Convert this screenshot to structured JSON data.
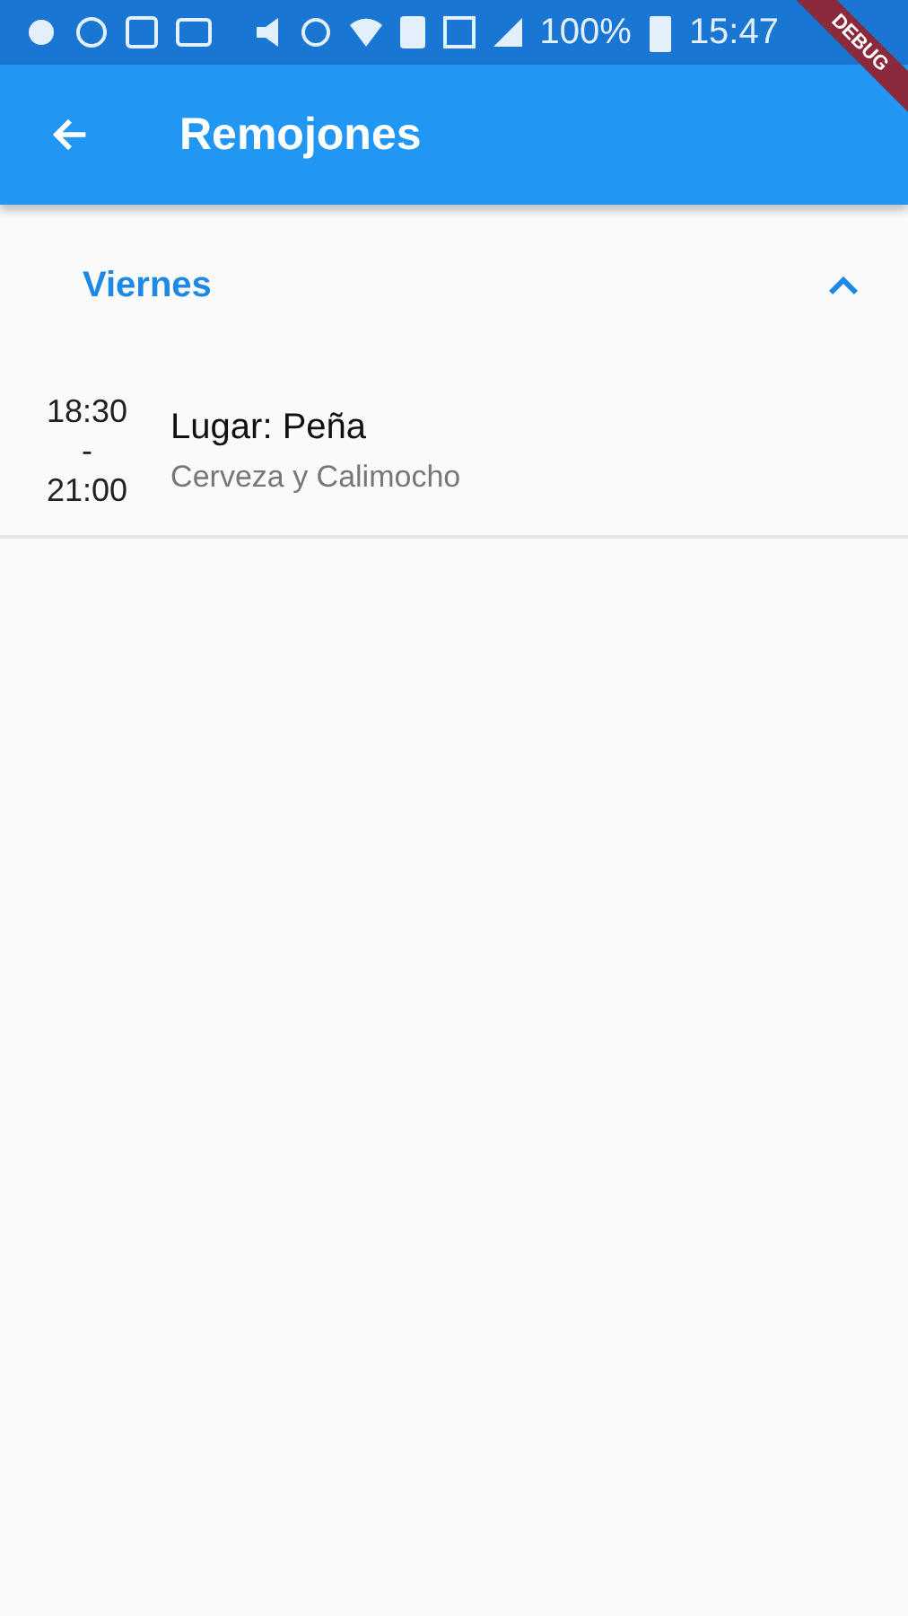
{
  "status_bar": {
    "battery": "100%",
    "time": "15:47"
  },
  "app_bar": {
    "title": "Remojones"
  },
  "debug_banner": "DEBUG",
  "sections": [
    {
      "title": "Viernes",
      "expanded": true,
      "events": [
        {
          "start": "18:30",
          "separator": "-",
          "end": "21:00",
          "title": "Lugar: Peña",
          "subtitle": "Cerveza y Calimocho"
        }
      ]
    }
  ]
}
